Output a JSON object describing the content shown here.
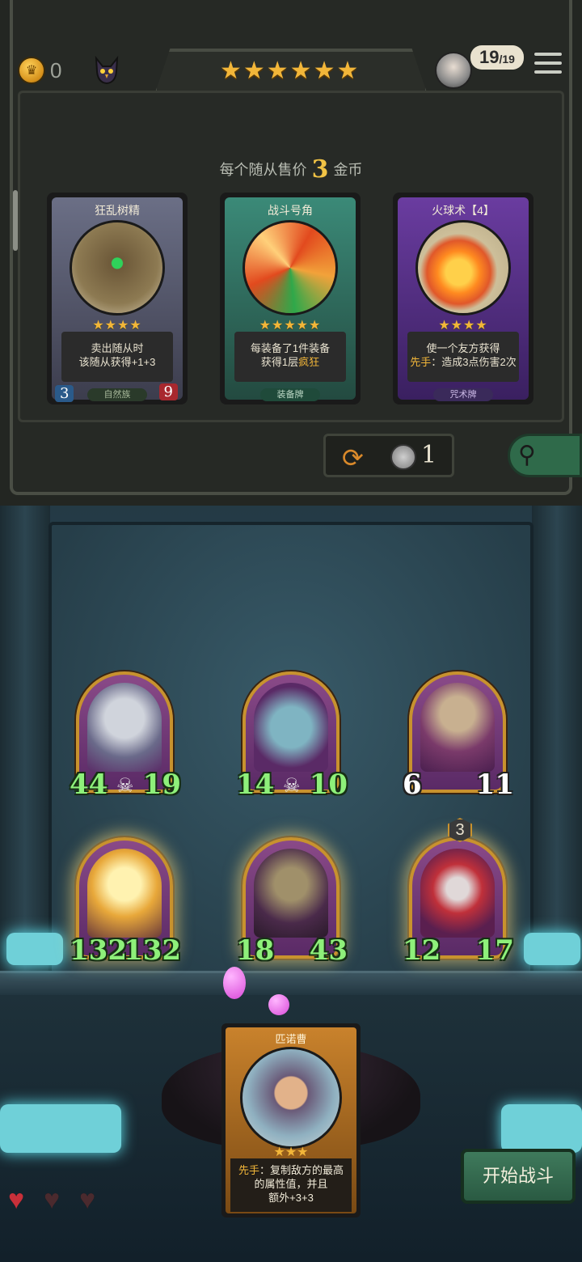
{
  "header": {
    "gold": "0",
    "tier_stars": "★★★★★★",
    "players_left": "19",
    "players_total": "/19"
  },
  "shop": {
    "sell_prefix": "每个随从售价",
    "sell_price": "3",
    "sell_suffix": "金币",
    "refresh_cost": "1",
    "cards": [
      {
        "name": "狂乱树精",
        "stars": "★★★★",
        "desc_line1": "卖出随从时",
        "desc_line2": "该随从获得+1+3",
        "tag": "自然族",
        "attack": "3",
        "health": "9"
      },
      {
        "name": "战斗号角",
        "stars": "★★★★★",
        "desc_line1": "每装备了1件装备",
        "desc_line2_a": "获得1层",
        "desc_line2_b": "疯狂",
        "tag": "装备牌"
      },
      {
        "name": "火球术【4】",
        "stars": "★★★★",
        "desc_line1": "使一个友方获得",
        "desc_line2_a": "先手",
        "desc_line2_b": "：造成3点伤害2次",
        "tag": "咒术牌"
      }
    ]
  },
  "board": {
    "minions": [
      {
        "attack": "44",
        "health": "19"
      },
      {
        "attack": "14",
        "health": "10"
      },
      {
        "attack": "6",
        "health": "11"
      },
      {
        "attack": "132",
        "health": "132"
      },
      {
        "attack": "18",
        "health": "43"
      },
      {
        "attack": "12",
        "health": "17",
        "tier": "3"
      }
    ]
  },
  "featured": {
    "name": "匹诺曹",
    "stars": "★★★",
    "desc_a": "先手",
    "desc_b": "：复制敌方的最高",
    "desc_line2": "的属性值，并且",
    "desc_line3": "额外+3+3"
  },
  "hearts": [
    "♥",
    "♥",
    "♥"
  ],
  "start_button": "开始战斗"
}
